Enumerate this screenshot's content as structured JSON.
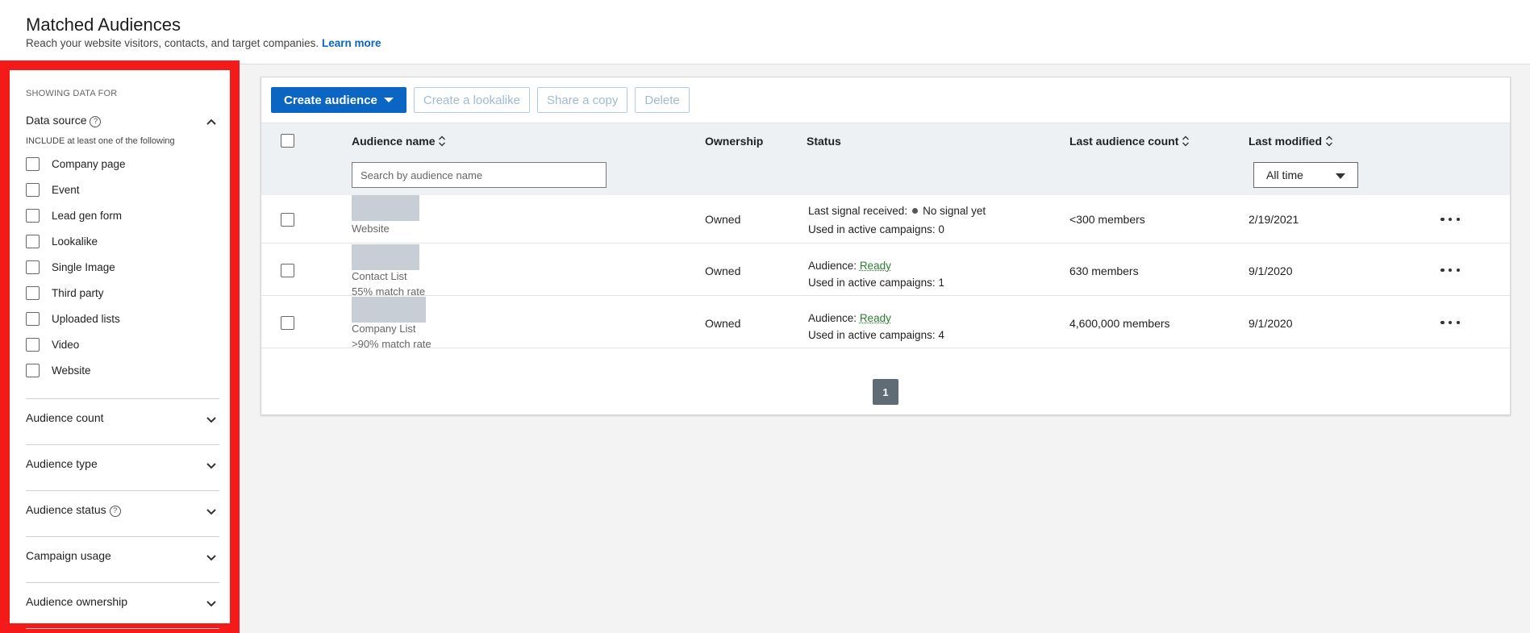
{
  "header": {
    "title": "Matched Audiences",
    "subtitle": "Reach your website visitors, contacts, and target companies.",
    "learn_more": "Learn more"
  },
  "sidebar": {
    "showing_label": "SHOWING DATA FOR",
    "data_source": {
      "label": "Data source",
      "include_note": "INCLUDE at least one of the following",
      "options": [
        "Company page",
        "Event",
        "Lead gen form",
        "Lookalike",
        "Single Image",
        "Third party",
        "Uploaded lists",
        "Video",
        "Website"
      ]
    },
    "sections": [
      {
        "label": "Audience count"
      },
      {
        "label": "Audience type"
      },
      {
        "label": "Audience status"
      },
      {
        "label": "Campaign usage"
      },
      {
        "label": "Audience ownership"
      }
    ]
  },
  "toolbar": {
    "create_audience": "Create audience",
    "create_lookalike": "Create a lookalike",
    "share_copy": "Share a copy",
    "delete": "Delete"
  },
  "table": {
    "columns": {
      "name": "Audience name",
      "ownership": "Ownership",
      "status": "Status",
      "last_count": "Last audience count",
      "last_modified": "Last modified"
    },
    "search_placeholder": "Search by audience name",
    "time_filter": "All time",
    "rows": [
      {
        "type": "Website",
        "match": "",
        "ownership": "Owned",
        "status_prefix": "Last signal received:",
        "status_value": "No signal yet",
        "campaigns": "Used in active campaigns: 0",
        "count": "<300 members",
        "modified": "2/19/2021"
      },
      {
        "type": "Contact List",
        "match": "55% match rate",
        "ownership": "Owned",
        "status_prefix": "Audience:",
        "status_value": "Ready",
        "campaigns": "Used in active campaigns: 1",
        "count": "630 members",
        "modified": "9/1/2020"
      },
      {
        "type": "Company List",
        "match": ">90% match rate",
        "ownership": "Owned",
        "status_prefix": "Audience:",
        "status_value": "Ready",
        "campaigns": "Used in active campaigns: 4",
        "count": "4,600,000 members",
        "modified": "9/1/2020"
      }
    ]
  },
  "pagination": {
    "current": "1"
  },
  "colors": {
    "primary": "#0a66c2",
    "highlight_border": "#f51a1a",
    "ready": "#2e7d32"
  }
}
